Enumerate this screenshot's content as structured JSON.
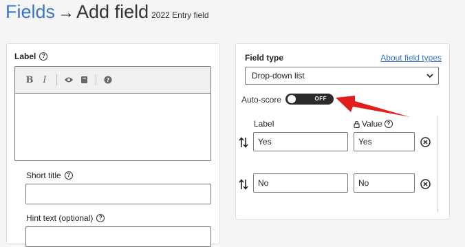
{
  "heading": {
    "crumb": "Fields",
    "arrow": "→",
    "title": "Add field",
    "subtitle": "2022 Entry field"
  },
  "label_section": {
    "label": "Label",
    "toolbar": {
      "bold": "B",
      "italic": "I",
      "icons": [
        "bold-icon",
        "italic-icon",
        "eye-icon",
        "book-icon",
        "help-icon"
      ]
    }
  },
  "short_title": {
    "label": "Short title",
    "value": ""
  },
  "hint_text": {
    "label": "Hint text (optional)",
    "value": ""
  },
  "field_type": {
    "label": "Field type",
    "about_link": "About field types",
    "selected": "Drop-down list"
  },
  "auto_score": {
    "label": "Auto-score",
    "state": "OFF",
    "on": false
  },
  "options": {
    "label_header": "Label",
    "value_header": "Value",
    "rows": [
      {
        "label": "Yes",
        "value": "Yes"
      },
      {
        "label": "No",
        "value": "No"
      }
    ]
  },
  "colors": {
    "link": "#3a75c4",
    "annotation_arrow": "#e01e1e",
    "toggle_off": "#2b2b2b"
  }
}
